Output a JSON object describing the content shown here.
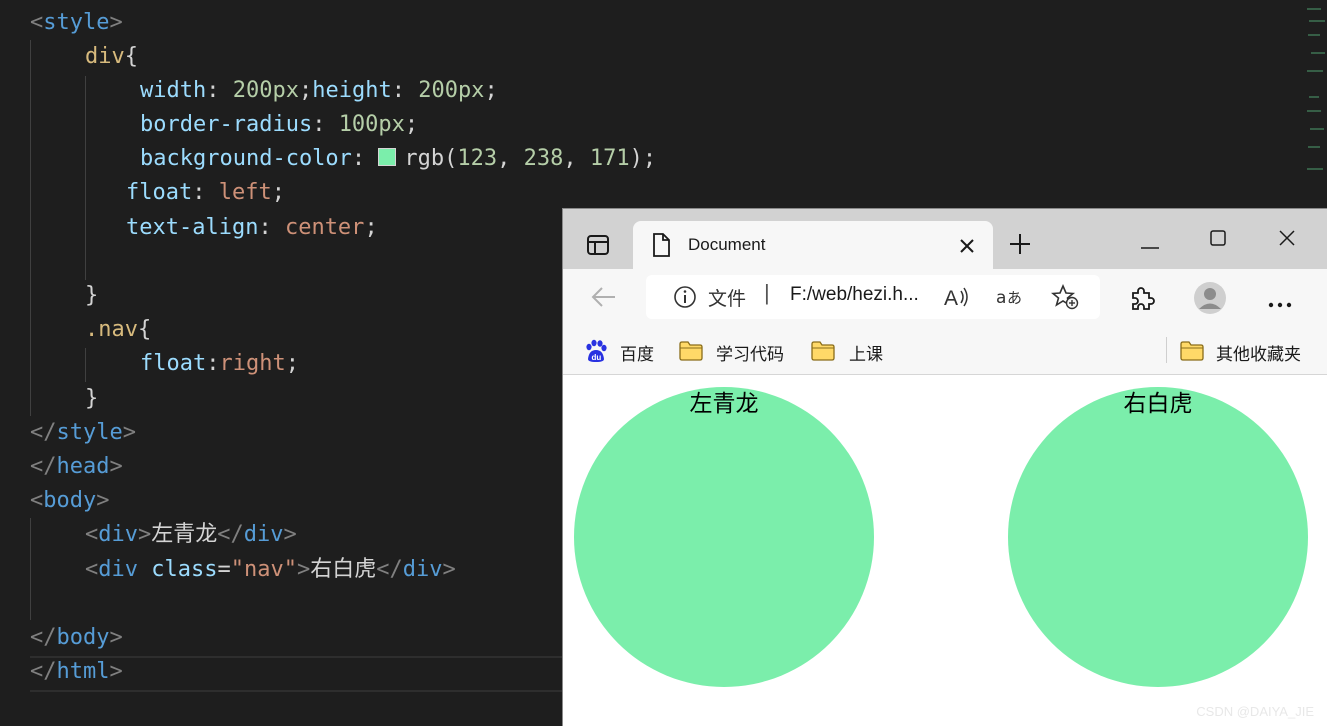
{
  "editor": {
    "lines": [
      {
        "id": "l-style-open",
        "tokens": [
          {
            "c": "tag-b",
            "t": "<"
          },
          {
            "c": "tag-n",
            "t": "style"
          },
          {
            "c": "tag-b",
            "t": ">"
          }
        ]
      },
      {
        "id": "l-div-selector",
        "tokens": [
          {
            "c": "sel",
            "t": "div"
          },
          {
            "c": "punc",
            "t": "{"
          }
        ]
      },
      {
        "id": "l-width-height",
        "tokens": [
          {
            "c": "prop",
            "t": "width"
          },
          {
            "c": "punc",
            "t": ": "
          },
          {
            "c": "num",
            "t": "200px"
          },
          {
            "c": "punc",
            "t": ";"
          },
          {
            "c": "prop",
            "t": "height"
          },
          {
            "c": "punc",
            "t": ": "
          },
          {
            "c": "num",
            "t": "200px"
          },
          {
            "c": "punc",
            "t": ";"
          }
        ]
      },
      {
        "id": "l-border-radius",
        "tokens": [
          {
            "c": "prop",
            "t": "border-radius"
          },
          {
            "c": "punc",
            "t": ": "
          },
          {
            "c": "num",
            "t": "100px"
          },
          {
            "c": "punc",
            "t": ";"
          }
        ]
      },
      {
        "id": "l-background-color",
        "tokens": [
          {
            "c": "prop",
            "t": "background-color"
          },
          {
            "c": "punc",
            "t": ": "
          },
          {
            "c": "swatch",
            "t": ""
          },
          {
            "c": "punc",
            "t": "rgb("
          },
          {
            "c": "num",
            "t": "123"
          },
          {
            "c": "punc",
            "t": ", "
          },
          {
            "c": "num",
            "t": "238"
          },
          {
            "c": "punc",
            "t": ", "
          },
          {
            "c": "num",
            "t": "171"
          },
          {
            "c": "punc",
            "t": ");"
          }
        ]
      },
      {
        "id": "l-float-left",
        "tokens": [
          {
            "c": "prop",
            "t": "float"
          },
          {
            "c": "punc",
            "t": ": "
          },
          {
            "c": "val",
            "t": "left"
          },
          {
            "c": "punc",
            "t": ";"
          }
        ]
      },
      {
        "id": "l-text-align",
        "tokens": [
          {
            "c": "prop",
            "t": "text-align"
          },
          {
            "c": "punc",
            "t": ": "
          },
          {
            "c": "val",
            "t": "center"
          },
          {
            "c": "punc",
            "t": ";"
          }
        ]
      },
      {
        "id": "l-blank-1",
        "tokens": []
      },
      {
        "id": "l-div-close",
        "tokens": [
          {
            "c": "punc",
            "t": "}"
          }
        ]
      },
      {
        "id": "l-nav-selector",
        "tokens": [
          {
            "c": "sel",
            "t": ".nav"
          },
          {
            "c": "punc",
            "t": "{"
          }
        ]
      },
      {
        "id": "l-float-right",
        "tokens": [
          {
            "c": "prop",
            "t": "float"
          },
          {
            "c": "punc",
            "t": ":"
          },
          {
            "c": "val",
            "t": "right"
          },
          {
            "c": "punc",
            "t": ";"
          }
        ]
      },
      {
        "id": "l-nav-close",
        "tokens": [
          {
            "c": "punc",
            "t": "}"
          }
        ]
      },
      {
        "id": "l-style-close",
        "tokens": [
          {
            "c": "tag-b",
            "t": "</"
          },
          {
            "c": "tag-n",
            "t": "style"
          },
          {
            "c": "tag-b",
            "t": ">"
          }
        ]
      },
      {
        "id": "l-head-close",
        "tokens": [
          {
            "c": "tag-b",
            "t": "</"
          },
          {
            "c": "tag-n",
            "t": "head"
          },
          {
            "c": "tag-b",
            "t": ">"
          }
        ]
      },
      {
        "id": "l-body-open",
        "tokens": [
          {
            "c": "tag-b",
            "t": "<"
          },
          {
            "c": "tag-n",
            "t": "body"
          },
          {
            "c": "tag-b",
            "t": ">"
          }
        ]
      },
      {
        "id": "l-div-left",
        "tokens": [
          {
            "c": "tag-b",
            "t": "<"
          },
          {
            "c": "tag-n",
            "t": "div"
          },
          {
            "c": "tag-b",
            "t": ">"
          },
          {
            "c": "txt",
            "t": "左青龙"
          },
          {
            "c": "tag-b",
            "t": "</"
          },
          {
            "c": "tag-n",
            "t": "div"
          },
          {
            "c": "tag-b",
            "t": ">"
          }
        ]
      },
      {
        "id": "l-div-nav",
        "tokens": [
          {
            "c": "tag-b",
            "t": "<"
          },
          {
            "c": "tag-n",
            "t": "div"
          },
          {
            "c": "punc",
            "t": " "
          },
          {
            "c": "attr",
            "t": "class"
          },
          {
            "c": "punc",
            "t": "="
          },
          {
            "c": "str",
            "t": "\"nav\""
          },
          {
            "c": "tag-b",
            "t": ">"
          },
          {
            "c": "txt",
            "t": "右白虎"
          },
          {
            "c": "tag-b",
            "t": "</"
          },
          {
            "c": "tag-n",
            "t": "div"
          },
          {
            "c": "tag-b",
            "t": ">"
          }
        ]
      },
      {
        "id": "l-blank-2",
        "tokens": []
      },
      {
        "id": "l-body-close",
        "tokens": [
          {
            "c": "tag-b",
            "t": "</"
          },
          {
            "c": "tag-n",
            "t": "body"
          },
          {
            "c": "tag-b",
            "t": ">"
          }
        ]
      },
      {
        "id": "l-html-close",
        "tokens": [
          {
            "c": "tag-b",
            "t": "</"
          },
          {
            "c": "tag-n",
            "t": "html"
          },
          {
            "c": "tag-b",
            "t": ">"
          }
        ]
      }
    ]
  },
  "browser": {
    "tab_title": "Document",
    "address_label": "文件",
    "address_separator": "|",
    "url": "F:/web/hezi.h...",
    "bookmarks": [
      "百度",
      "学习代码",
      "上课"
    ],
    "other_bookmarks": "其他收藏夹",
    "page": {
      "circle_left_text": "左青龙",
      "circle_right_text": "右白虎",
      "circle_color": "#7beeab"
    },
    "watermark": "CSDN @DAIYA_JIE"
  },
  "icons": [
    "sidebar-icon",
    "document-icon",
    "close-tab-icon",
    "new-tab-icon",
    "minimize-icon",
    "maximize-icon",
    "close-window-icon",
    "back-arrow-icon",
    "info-icon",
    "read-aloud-icon",
    "translate-icon",
    "add-favorite-icon",
    "extensions-icon",
    "profile-icon",
    "more-menu-icon",
    "baidu-icon",
    "folder-icon"
  ]
}
